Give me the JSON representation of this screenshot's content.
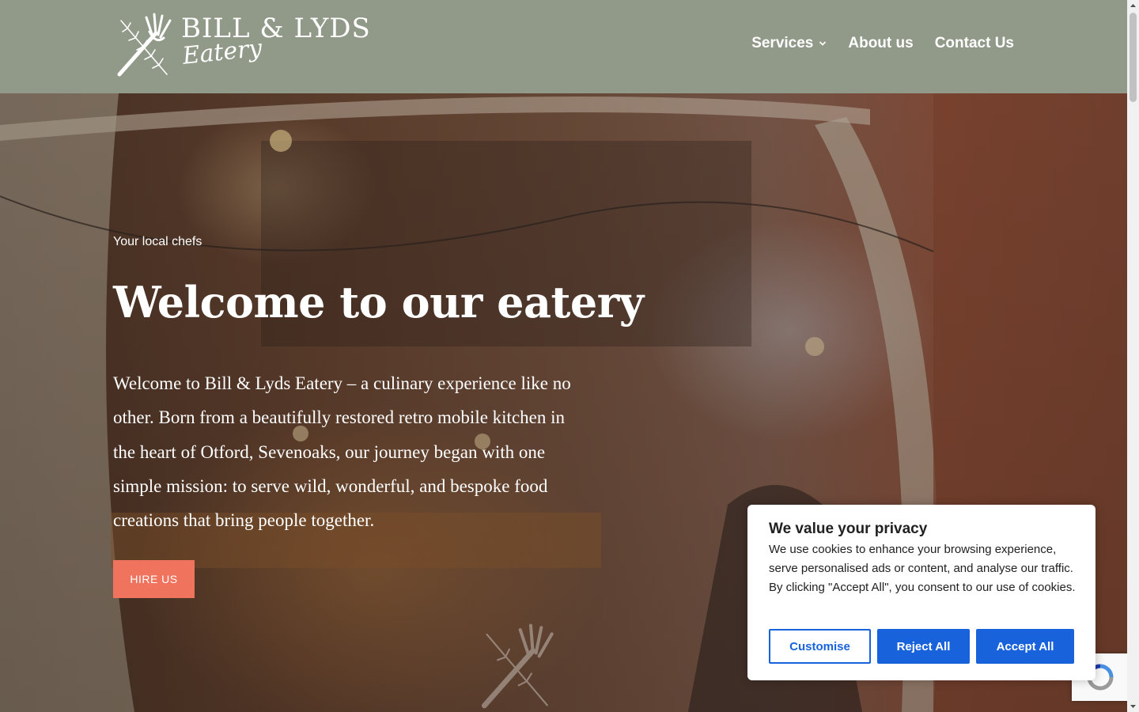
{
  "header": {
    "logo": {
      "name": "BILL & LYDS",
      "sub": "Eatery"
    },
    "nav": [
      {
        "label": "Services",
        "has_dropdown": true,
        "icon": "chevron-down-icon"
      },
      {
        "label": "About us"
      },
      {
        "label": "Contact Us"
      }
    ]
  },
  "hero": {
    "eyebrow": "Your local chefs",
    "title": "Welcome to our eatery",
    "intro": "Welcome to Bill & Lyds Eatery – a culinary experience like no other. Born from a beautifully restored retro mobile kitchen in the heart of Otford, Sevenoaks, our journey began with one simple mission: to serve wild, wonderful, and bespoke food creations that bring people together.",
    "cta_label": "HIRE US"
  },
  "cookie_banner": {
    "title": "We value your privacy",
    "body": "We use cookies to enhance your browsing experience, serve personalised ads or content, and analyse our traffic. By clicking \"Accept All\", you consent to our use of cookies.",
    "customise_label": "Customise",
    "reject_label": "Reject All",
    "accept_label": "Accept All"
  },
  "colors": {
    "header_bg": "#919a88",
    "cta_bg": "#f0735e",
    "cookie_accent": "#1863dc"
  }
}
